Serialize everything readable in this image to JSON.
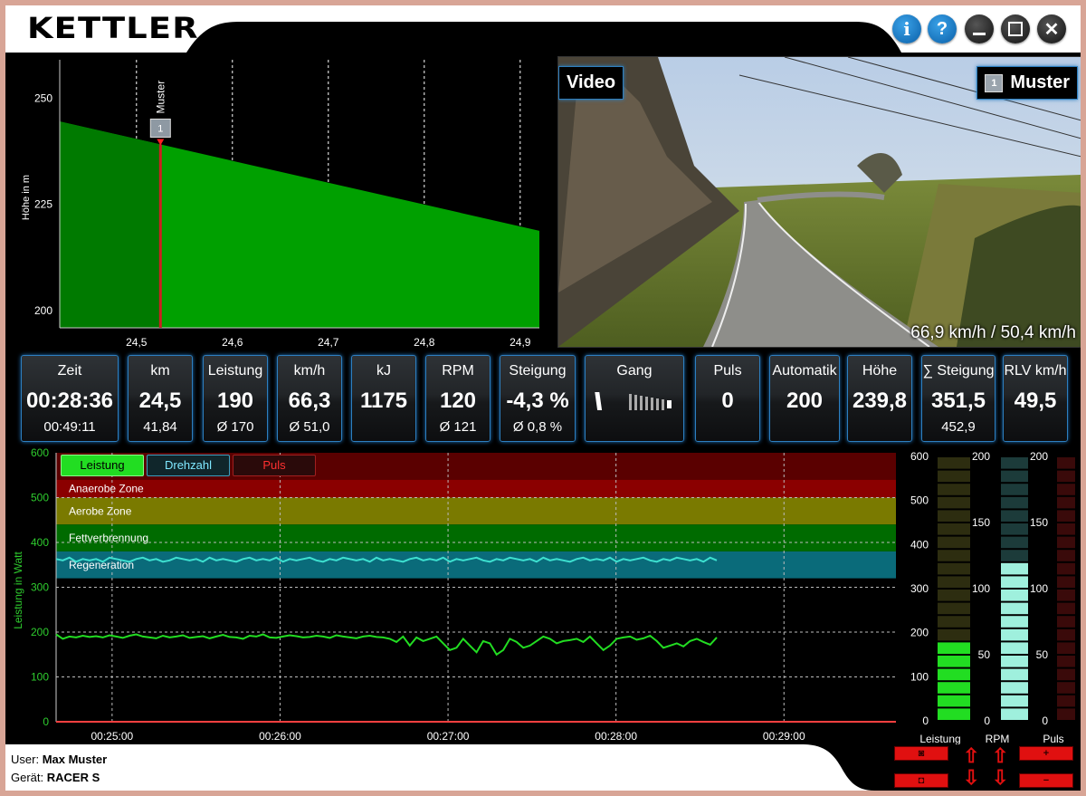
{
  "header": {
    "logo": "KETTLER"
  },
  "window_buttons": [
    {
      "name": "info-button",
      "glyph": "i"
    },
    {
      "name": "help-button",
      "glyph": "?"
    },
    {
      "name": "minimize-button",
      "glyph": "–"
    },
    {
      "name": "maximize-button",
      "glyph": "☐"
    },
    {
      "name": "close-button",
      "glyph": "✕"
    }
  ],
  "profile": {
    "ylabel": "Höhe in m",
    "y_ticks": [
      "250",
      "225",
      "200"
    ],
    "x_ticks": [
      "24,5",
      "24,6",
      "24,7",
      "24,8",
      "24,9"
    ],
    "marker_name": "Muster",
    "marker_number": "1"
  },
  "video": {
    "label": "Video",
    "rider_number": "1",
    "rider_name": "Muster",
    "speed_overlay": "66,9 km/h / 50,4 km/h"
  },
  "stats": [
    {
      "label": "Zeit",
      "value": "00:28:36",
      "sub": "00:49:11"
    },
    {
      "label": "km",
      "value": "24,5",
      "sub": "41,84"
    },
    {
      "label": "Leistung",
      "value": "190",
      "sub": "Ø 170"
    },
    {
      "label": "km/h",
      "value": "66,3",
      "sub": "Ø 51,0"
    },
    {
      "label": "kJ",
      "value": "1175",
      "sub": ""
    },
    {
      "label": "RPM",
      "value": "120",
      "sub": "Ø 121"
    },
    {
      "label": "Steigung",
      "value": "-4,3 %",
      "sub": "Ø 0,8 %"
    },
    {
      "label": "Gang",
      "value": "",
      "sub": ""
    },
    {
      "label": "Puls",
      "value": "0",
      "sub": ""
    },
    {
      "label": "Automatik",
      "value": "200",
      "sub": ""
    },
    {
      "label": "Höhe",
      "value": "239,8",
      "sub": ""
    },
    {
      "label": "∑ Steigung",
      "value": "351,5",
      "sub": "452,9"
    },
    {
      "label": "RLV km/h",
      "value": "49,5",
      "sub": ""
    }
  ],
  "bottom_chart": {
    "ylabel": "Leistung in Watt",
    "y_ticks": [
      "600",
      "500",
      "400",
      "300",
      "200",
      "100",
      "0"
    ],
    "x_ticks": [
      "00:25:00",
      "00:26:00",
      "00:27:00",
      "00:28:00",
      "00:29:00"
    ],
    "legend": [
      "Leistung",
      "Drehzahl",
      "Puls"
    ],
    "zones": [
      "Anaerobe Zone",
      "Aerobe Zone",
      "Fettverbrennung",
      "Regeneration"
    ]
  },
  "meters": {
    "left_ticks": [
      "600",
      "500",
      "400",
      "300",
      "200",
      "100",
      "0"
    ],
    "mid_ticks": [
      "200",
      "150",
      "100",
      "50",
      "0"
    ],
    "right_ticks": [
      "200",
      "150",
      "100",
      "50",
      "0"
    ],
    "labels": [
      "Leistung",
      "RPM",
      "Puls"
    ],
    "leistung_fraction": 0.32,
    "rpm_fraction": 0.6,
    "puls_fraction": 0
  },
  "footer": {
    "user_label": "User:",
    "user_value": "Max Muster",
    "device_label": "Gerät:",
    "device_value": "RACER S"
  },
  "chart_data": [
    {
      "type": "area",
      "title": "",
      "xlabel": "",
      "ylabel": "Höhe in m",
      "x": [
        24.42,
        24.92
      ],
      "y": [
        244.5,
        218.8
      ],
      "xlim": [
        24.42,
        24.92
      ],
      "ylim": [
        196,
        259
      ],
      "marker_x": 24.525
    },
    {
      "type": "line",
      "title": "",
      "ylabel": "Leistung in Watt",
      "ylim": [
        0,
        600
      ],
      "xlim": [
        "00:24:40",
        "00:29:40"
      ],
      "series": [
        {
          "name": "Leistung",
          "color": "#22dd22",
          "x_start": "00:24:40",
          "x_end": "00:28:36",
          "values": [
            195,
            185,
            190,
            188,
            192,
            189,
            191,
            188,
            193,
            190,
            187,
            192,
            195,
            190,
            188,
            186,
            192,
            188,
            190,
            193,
            187,
            189,
            191,
            186,
            190,
            194,
            189,
            188,
            185,
            192,
            190,
            195,
            188,
            187,
            190,
            193,
            191,
            188,
            189,
            192,
            190,
            187,
            193,
            190,
            188,
            186,
            190,
            192,
            189,
            188,
            185,
            178,
            190,
            170,
            188,
            180,
            185,
            190,
            175,
            160,
            165,
            185,
            170,
            155,
            180,
            175,
            150,
            160,
            185,
            178,
            165,
            170,
            180,
            190,
            185,
            175,
            180,
            182,
            185,
            178,
            190,
            175,
            160,
            170,
            185,
            188,
            190,
            183,
            186,
            192,
            180,
            165,
            170,
            175,
            168,
            180,
            185,
            178,
            172,
            188
          ]
        },
        {
          "name": "Drehzahl",
          "color": "#3de0d0",
          "x_start": "00:24:40",
          "x_end": "00:28:36",
          "values": [
            121,
            120,
            122,
            119,
            121,
            120,
            121,
            119,
            122,
            121,
            120,
            119,
            121,
            122,
            120,
            121,
            119,
            120,
            122,
            121,
            120,
            121,
            119,
            122,
            120,
            121,
            120,
            119,
            121,
            122,
            120,
            121,
            120,
            122,
            119,
            121,
            120,
            121,
            122,
            120,
            119,
            121,
            120,
            122,
            121,
            120,
            121,
            119,
            122,
            120,
            121,
            120,
            119,
            121,
            122,
            120,
            121,
            120,
            122,
            119,
            121,
            120,
            121,
            122,
            120,
            119,
            121,
            120,
            122,
            121,
            120,
            121,
            119,
            122,
            120,
            121,
            120,
            119,
            121,
            122,
            120,
            121,
            120,
            122,
            119,
            121,
            120,
            121,
            122,
            120,
            119,
            121,
            120,
            122,
            121,
            120,
            121,
            119,
            122,
            120
          ]
        },
        {
          "name": "Puls",
          "color": "#ff2020",
          "values": [
            0
          ]
        }
      ],
      "zones": [
        {
          "name": "Anaerobe Zone",
          "from": 500,
          "to": 540,
          "color": "#8b0000"
        },
        {
          "name": "Aerobe Zone",
          "from": 440,
          "to": 500,
          "color": "#7a7a00"
        },
        {
          "name": "Fettverbrennung",
          "from": 380,
          "to": 440,
          "color": "#006b00"
        },
        {
          "name": "Regeneration",
          "from": 320,
          "to": 380,
          "color": "#0a6b7a"
        }
      ]
    }
  ]
}
